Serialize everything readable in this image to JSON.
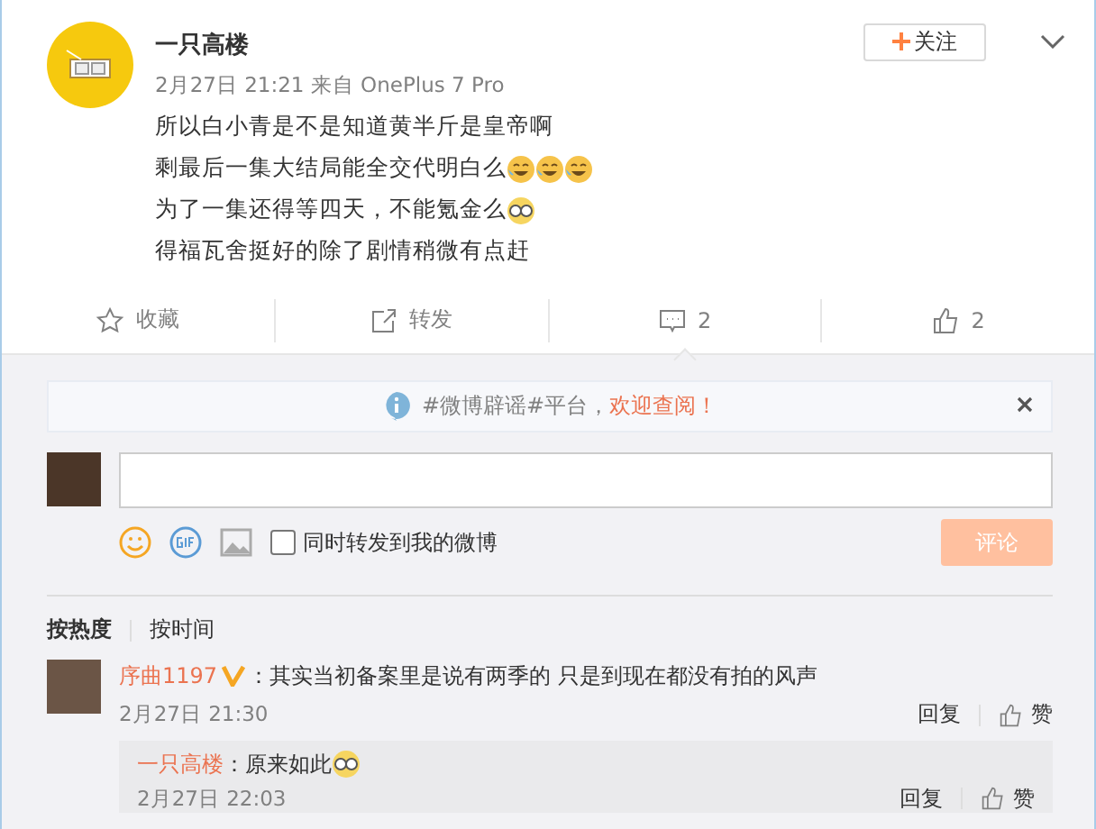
{
  "post": {
    "author": "一只高楼",
    "follow_label": "关注",
    "meta": "2月27日 21:21 来自 OnePlus 7 Pro",
    "lines": [
      {
        "text": "所以白小青是不是知道黄半斤是皇帝啊"
      },
      {
        "text": "剩最后一集大结局能全交代明白么",
        "emojis": [
          {
            "kind": "tears"
          },
          {
            "kind": "tears"
          },
          {
            "kind": "tears"
          }
        ]
      },
      {
        "text": "为了一集还得等四天，不能氪金么",
        "emojis": [
          {
            "kind": "glasses"
          }
        ]
      },
      {
        "text": "得福瓦舍挺好的除了剧情稍微有点赶"
      }
    ]
  },
  "actions": [
    {
      "kind": "star",
      "label": "收藏"
    },
    {
      "kind": "share",
      "label": "转发"
    },
    {
      "kind": "comment",
      "label": "2"
    },
    {
      "kind": "like",
      "label": "2"
    }
  ],
  "notice": {
    "text": "#微博辟谣#平台，",
    "link": "欢迎查阅！"
  },
  "composer": {
    "repost_label": "同时转发到我的微博",
    "repost_checked": false,
    "submit": "评论",
    "submit_disabled": true
  },
  "sort_tabs": [
    {
      "label": "按热度",
      "selected": true
    },
    {
      "label": "按时间",
      "selected": false
    }
  ],
  "comments": [
    {
      "user": "序曲1197",
      "verified": true,
      "text": "：其实当初备案里是说有两季的 只是到现在都没有拍的风声",
      "time": "2月27日 21:30",
      "reply": "回复",
      "like": "赞",
      "replies": [
        {
          "user": "一只高楼",
          "text": "：原来如此",
          "emojis": [
            {
              "kind": "glasses"
            }
          ],
          "time": "2月27日 22:03",
          "reply": "回复",
          "like": "赞"
        }
      ]
    }
  ]
}
